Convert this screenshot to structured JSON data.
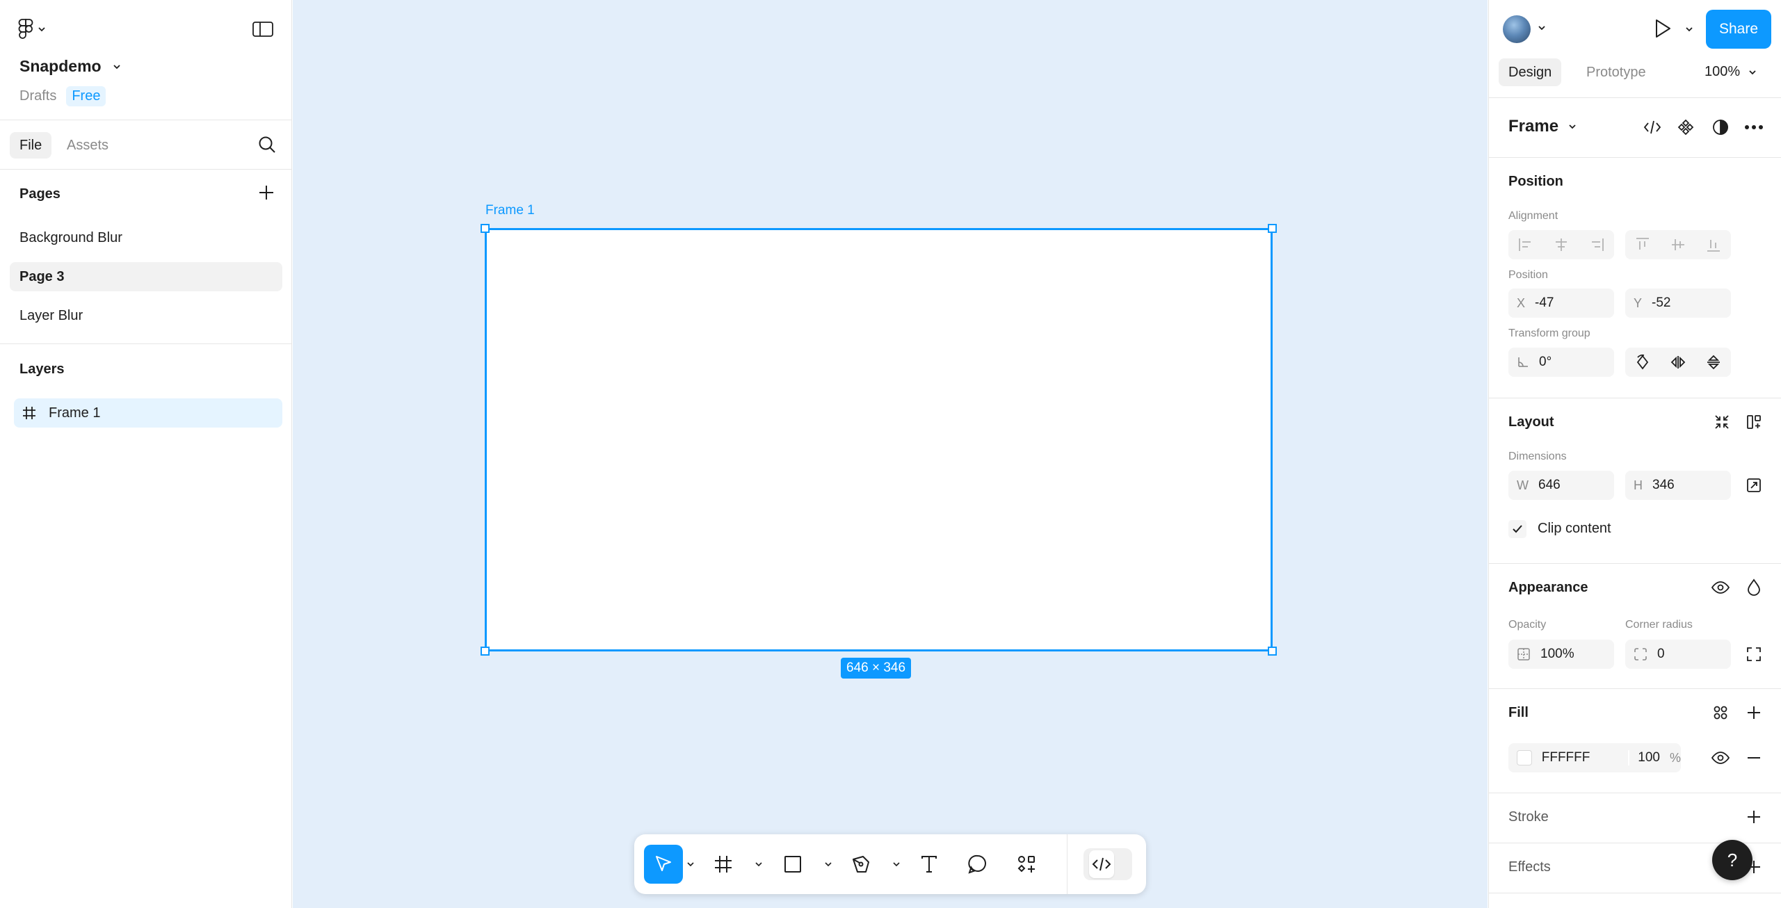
{
  "file": {
    "name": "Snapdemo",
    "location": "Drafts",
    "plan": "Free"
  },
  "left_tabs": [
    "File",
    "Assets"
  ],
  "pages": {
    "title": "Pages",
    "items": [
      "Background Blur",
      "Page 3",
      "Layer Blur"
    ],
    "active": "Page 3"
  },
  "layers": {
    "title": "Layers",
    "items": [
      "Frame 1"
    ]
  },
  "canvas": {
    "frame_name": "Frame 1",
    "dimensions_badge": "646 × 346",
    "background": "#e3eefa",
    "accent": "#0d99ff"
  },
  "right": {
    "share_label": "Share",
    "tabs": [
      "Design",
      "Prototype"
    ],
    "zoom": "100%",
    "selection_type": "Frame",
    "position": {
      "title": "Position",
      "alignment_label": "Alignment",
      "position_label": "Position",
      "x_prefix": "X",
      "x": "-47",
      "y_prefix": "Y",
      "y": "-52",
      "transform_label": "Transform group",
      "rotation": "0°"
    },
    "layout": {
      "title": "Layout",
      "dimensions_label": "Dimensions",
      "w_prefix": "W",
      "w": "646",
      "h_prefix": "H",
      "h": "346",
      "clip_content": "Clip content"
    },
    "appearance": {
      "title": "Appearance",
      "opacity_label": "Opacity",
      "opacity": "100%",
      "radius_label": "Corner radius",
      "radius": "0"
    },
    "fill": {
      "title": "Fill",
      "hex": "FFFFFF",
      "opacity": "100",
      "unit": "%"
    },
    "stroke_title": "Stroke",
    "effects_title": "Effects"
  },
  "help_label": "?"
}
